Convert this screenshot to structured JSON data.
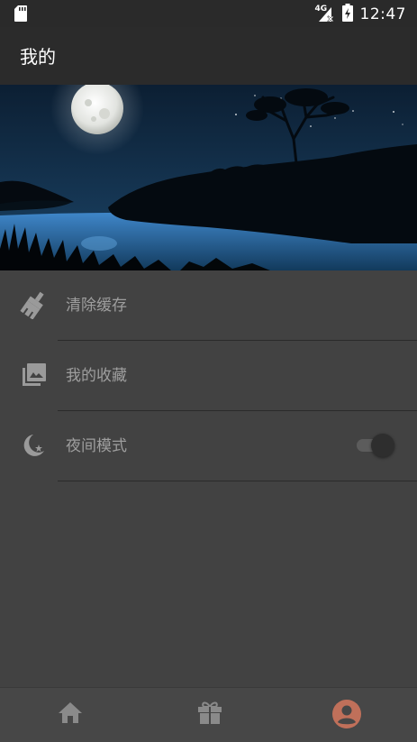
{
  "status_bar": {
    "time": "12:47",
    "network_label": "4G",
    "icons": [
      "sd-card-icon",
      "cellular-signal-icon",
      "battery-charging-icon"
    ]
  },
  "app_bar": {
    "title": "我的"
  },
  "banner": {
    "image": "moonlit-lake-night-scene"
  },
  "menu": {
    "items": [
      {
        "label": "清除缓存",
        "icon": "broom-icon"
      },
      {
        "label": "我的收藏",
        "icon": "photo-library-icon"
      },
      {
        "label": "夜间模式",
        "icon": "moon-stars-icon",
        "toggle_on": false
      }
    ]
  },
  "bottom_nav": {
    "tabs": [
      {
        "icon": "home-icon",
        "active": false
      },
      {
        "icon": "gift-icon",
        "active": false
      },
      {
        "icon": "account-icon",
        "active": true
      }
    ]
  },
  "colors": {
    "background": "#424242",
    "app_bar": "#2b2b2b",
    "menu_text": "#9e9e9e",
    "icon_gray": "#9a9a9a",
    "nav_active": "#c0705a",
    "nav_inactive": "#8a8a8a"
  }
}
